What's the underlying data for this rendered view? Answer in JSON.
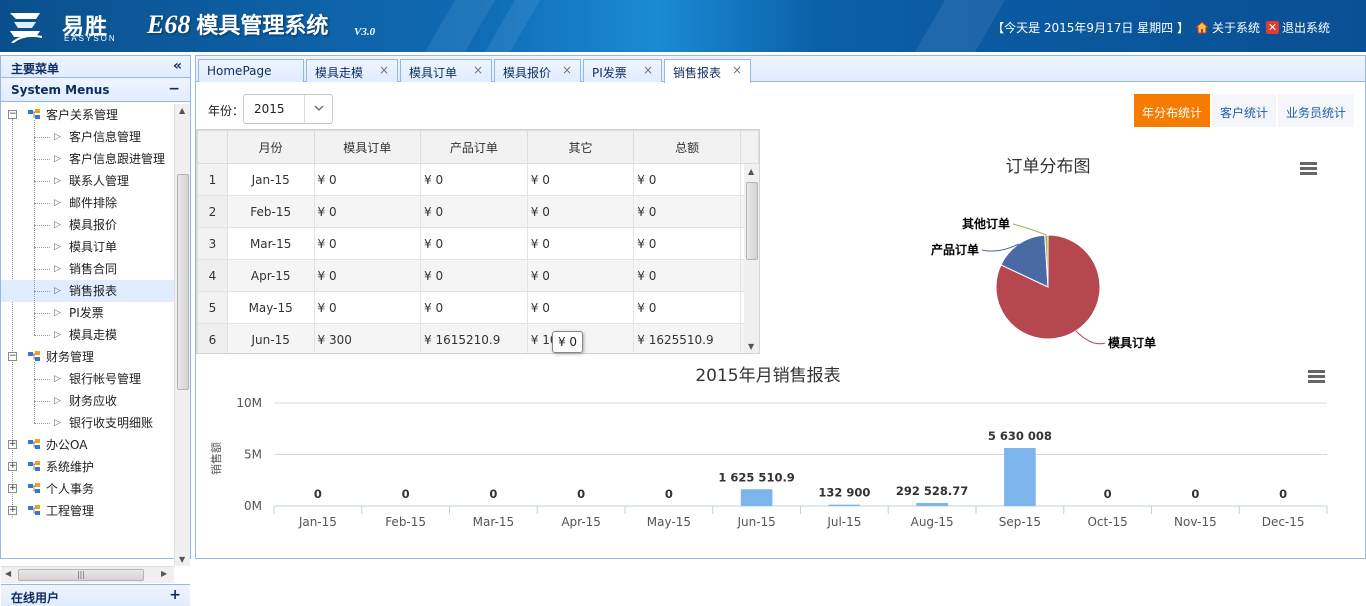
{
  "header": {
    "logo_cn": "易胜",
    "logo_en": "EASYSON",
    "title_prefix": "E68",
    "title_cn": "模具管理系统",
    "version": "V3.0",
    "date_text": "【今天是 2015年9月17日 星期四 】",
    "about_label": "关于系统",
    "exit_label": "退出系统"
  },
  "sidebar": {
    "title": "主要菜单",
    "collapse_glyph": "«",
    "section": "System Menus",
    "section_glyph": "−",
    "footer": "在线用户",
    "footer_glyph": "+",
    "tree": [
      {
        "label": "客户关系管理",
        "children": [
          "客户信息管理",
          "客户信息跟进管理",
          "联系人管理",
          "邮件排除",
          "模具报价",
          "模具订单",
          "销售合同",
          "销售报表",
          "PI发票",
          "模具走模"
        ]
      },
      {
        "label": "财务管理",
        "children": [
          "银行帐号管理",
          "财务应收",
          "银行收支明细账"
        ]
      },
      {
        "label": "办公OA",
        "children": []
      },
      {
        "label": "系统维护",
        "children": []
      },
      {
        "label": "个人事务",
        "children": []
      },
      {
        "label": "工程管理",
        "children": []
      }
    ],
    "selected": "销售报表"
  },
  "tabs": [
    {
      "label": "HomePage",
      "closable": false
    },
    {
      "label": "模具走模",
      "closable": true
    },
    {
      "label": "模具订单",
      "closable": true
    },
    {
      "label": "模具报价",
      "closable": true
    },
    {
      "label": "PI发票",
      "closable": true
    },
    {
      "label": "销售报表",
      "closable": true,
      "active": true
    }
  ],
  "tab_close_glyph": "×",
  "filter": {
    "year_label": "年份：",
    "year_value": "2015"
  },
  "stat_buttons": [
    {
      "label": "年分布统计",
      "active": true
    },
    {
      "label": "客户统计",
      "active": false
    },
    {
      "label": "业务员统计",
      "active": false
    }
  ],
  "grid": {
    "columns": [
      "月份",
      "模具订单",
      "产品订单",
      "其它",
      "总额"
    ],
    "rows": [
      {
        "n": "1",
        "month": "Jan-15",
        "mold": "¥ 0",
        "product": "¥ 0",
        "other": "¥ 0",
        "total": "¥ 0"
      },
      {
        "n": "2",
        "month": "Feb-15",
        "mold": "¥ 0",
        "product": "¥ 0",
        "other": "¥ 0",
        "total": "¥ 0"
      },
      {
        "n": "3",
        "month": "Mar-15",
        "mold": "¥ 0",
        "product": "¥ 0",
        "other": "¥ 0",
        "total": "¥ 0"
      },
      {
        "n": "4",
        "month": "Apr-15",
        "mold": "¥ 0",
        "product": "¥ 0",
        "other": "¥ 0",
        "total": "¥ 0"
      },
      {
        "n": "5",
        "month": "May-15",
        "mold": "¥ 0",
        "product": "¥ 0",
        "other": "¥ 0",
        "total": "¥ 0"
      },
      {
        "n": "6",
        "month": "Jun-15",
        "mold": "¥ 300",
        "product": "¥ 1615210.9",
        "other": "¥ 10",
        "total": "¥ 1625510.9"
      }
    ],
    "tooltip": "¥ 0"
  },
  "chart_data": [
    {
      "type": "pie",
      "title": "订单分布图",
      "slices": [
        {
          "name": "模具订单",
          "value": 82,
          "color": "#b5474f"
        },
        {
          "name": "产品订单",
          "value": 17,
          "color": "#4a6aa5"
        },
        {
          "name": "其他订单",
          "value": 1,
          "color": "#9fb553"
        }
      ]
    },
    {
      "type": "bar",
      "title": "2015年月销售报表",
      "ylabel": "销售额",
      "categories": [
        "Jan-15",
        "Feb-15",
        "Mar-15",
        "Apr-15",
        "May-15",
        "Jun-15",
        "Jul-15",
        "Aug-15",
        "Sep-15",
        "Oct-15",
        "Nov-15",
        "Dec-15"
      ],
      "values": [
        0,
        0,
        0,
        0,
        0,
        1625510.9,
        132900,
        292528.77,
        5630008,
        0,
        0,
        0
      ],
      "data_labels": [
        "0",
        "0",
        "0",
        "0",
        "0",
        "1 625 510.9",
        "132 900",
        "292 528.77",
        "5 630 008",
        "0",
        "0",
        "0"
      ],
      "yticks": [
        "0M",
        "5M",
        "10M"
      ],
      "ylim": [
        0,
        10000000
      ],
      "bar_color": "#7cb5ec",
      "grid": true
    }
  ]
}
